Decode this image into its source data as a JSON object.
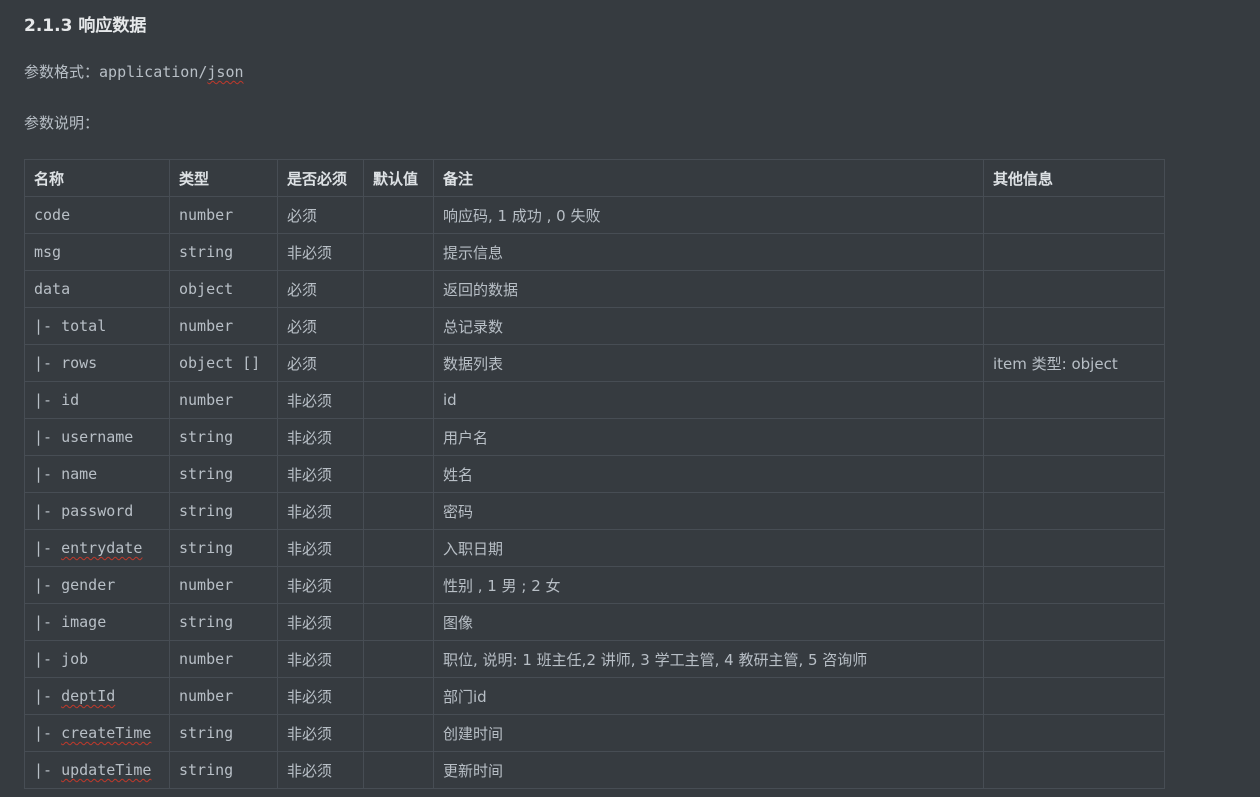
{
  "section": {
    "title": "2.1.3 响应数据",
    "format_label": "参数格式：",
    "format_value": "application/",
    "format_value_flagged": "json",
    "desc_label": "参数说明："
  },
  "table": {
    "headers": [
      "名称",
      "类型",
      "是否必须",
      "默认值",
      "备注",
      "其他信息"
    ],
    "rows": [
      {
        "name_prefix": "",
        "name": "code",
        "name_flagged": false,
        "type": "number",
        "required": "必须",
        "default": "",
        "note": "响应码, 1 成功 , 0 失败",
        "other": ""
      },
      {
        "name_prefix": "",
        "name": "msg",
        "name_flagged": false,
        "type": "string",
        "required": "非必须",
        "default": "",
        "note": "提示信息",
        "other": ""
      },
      {
        "name_prefix": "",
        "name": "data",
        "name_flagged": false,
        "type": "object",
        "required": "必须",
        "default": "",
        "note": "返回的数据",
        "other": ""
      },
      {
        "name_prefix": "|- ",
        "name": "total",
        "name_flagged": false,
        "type": "number",
        "required": "必须",
        "default": "",
        "note": "总记录数",
        "other": ""
      },
      {
        "name_prefix": "|- ",
        "name": "rows",
        "name_flagged": false,
        "type": "object []",
        "required": "必须",
        "default": "",
        "note": "数据列表",
        "other": "item 类型: object"
      },
      {
        "name_prefix": "|- ",
        "name": "id",
        "name_flagged": false,
        "type": "number",
        "required": "非必须",
        "default": "",
        "note": "id",
        "other": ""
      },
      {
        "name_prefix": "|- ",
        "name": "username",
        "name_flagged": false,
        "type": "string",
        "required": "非必须",
        "default": "",
        "note": "用户名",
        "other": ""
      },
      {
        "name_prefix": "|- ",
        "name": "name",
        "name_flagged": false,
        "type": "string",
        "required": "非必须",
        "default": "",
        "note": "姓名",
        "other": ""
      },
      {
        "name_prefix": "|- ",
        "name": "password",
        "name_flagged": false,
        "type": "string",
        "required": "非必须",
        "default": "",
        "note": "密码",
        "other": ""
      },
      {
        "name_prefix": "|- ",
        "name": "entrydate",
        "name_flagged": true,
        "type": "string",
        "required": "非必须",
        "default": "",
        "note": "入职日期",
        "other": ""
      },
      {
        "name_prefix": "|- ",
        "name": "gender",
        "name_flagged": false,
        "type": "number",
        "required": "非必须",
        "default": "",
        "note": "性别 , 1 男 ; 2 女",
        "other": ""
      },
      {
        "name_prefix": "|- ",
        "name": "image",
        "name_flagged": false,
        "type": "string",
        "required": "非必须",
        "default": "",
        "note": "图像",
        "other": ""
      },
      {
        "name_prefix": "|- ",
        "name": "job",
        "name_flagged": false,
        "type": "number",
        "required": "非必须",
        "default": "",
        "note": "职位, 说明: 1 班主任,2 讲师, 3 学工主管, 4 教研主管, 5 咨询师",
        "other": ""
      },
      {
        "name_prefix": "|- ",
        "name": "deptId",
        "name_flagged": true,
        "type": "number",
        "required": "非必须",
        "default": "",
        "note": "部门id",
        "other": ""
      },
      {
        "name_prefix": "|- ",
        "name": "createTime",
        "name_flagged": true,
        "type": "string",
        "required": "非必须",
        "default": "",
        "note": "创建时间",
        "other": ""
      },
      {
        "name_prefix": "|- ",
        "name": "updateTime",
        "name_flagged": true,
        "type": "string",
        "required": "非必须",
        "default": "",
        "note": "更新时间",
        "other": ""
      }
    ]
  }
}
